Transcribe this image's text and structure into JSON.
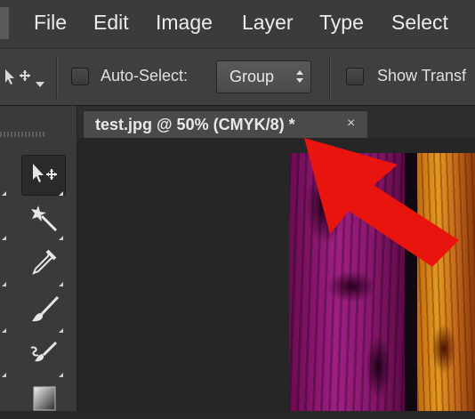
{
  "menu": {
    "items": [
      "File",
      "Edit",
      "Image",
      "Layer",
      "Type",
      "Select"
    ]
  },
  "options": {
    "auto_select_label": "Auto-Select:",
    "group_value": "Group",
    "show_transform_label": "Show Transf"
  },
  "document": {
    "tab_title": "test.jpg @ 50% (CMYK/8) *",
    "close_glyph": "×"
  },
  "tools": [
    "move-tool",
    "magic-wand-tool",
    "eyedropper-tool",
    "brush-tool",
    "healing-brush-tool",
    "gradient-tool"
  ],
  "colors": {
    "accent_arrow": "#e8150f",
    "chrome": "#3b3b3b",
    "canvas": "#262626"
  }
}
